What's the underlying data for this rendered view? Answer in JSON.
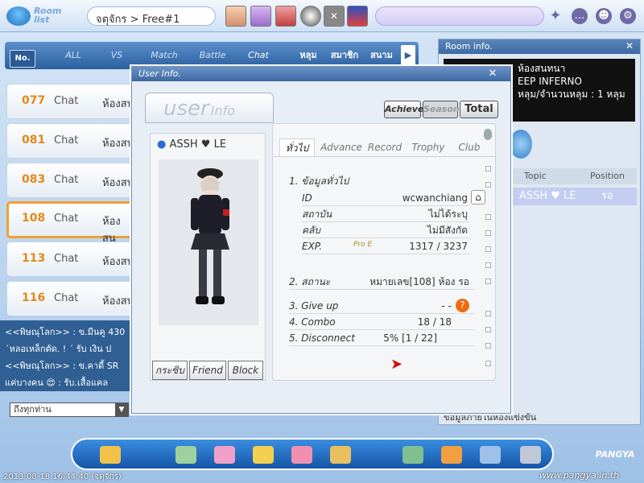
{
  "topbar": {
    "roomlist_label_1": "Room",
    "roomlist_label_2": "list",
    "breadcrumb": "จตุจักร > Free#1"
  },
  "tabs": {
    "no": "No.",
    "all": "ALL",
    "vs": "VS",
    "match": "Match",
    "battle": "Battle",
    "chat": "Chat",
    "hole": "หลุม",
    "member": "สมาชิก",
    "field": "สนาม"
  },
  "rooms": [
    {
      "num": "077",
      "type": "Chat",
      "name": "ห้องสน"
    },
    {
      "num": "081",
      "type": "Chat",
      "name": "ห้องสน"
    },
    {
      "num": "083",
      "type": "Chat",
      "name": "ห้องสน"
    },
    {
      "num": "108",
      "type": "Chat",
      "name": "ห้องสน"
    },
    {
      "num": "113",
      "type": "Chat",
      "name": "ห้องสน"
    },
    {
      "num": "116",
      "type": "Chat",
      "name": "ห้องสน"
    }
  ],
  "chatlog": [
    "<<พิษณุโลก>> : ข.มีนคู 430",
    "´หลอเหล็กตัด. ! ´ รับ เงิน ป",
    "<<พิษณุโลก>> : ข.คาดี้ SR",
    "แค่บางคน 😍 : รับ.เสื้อแคล"
  ],
  "chat_select": "ถึงทุกท่าน",
  "roominfo": {
    "title": "Room info.",
    "line1": "ห้องสนทนา",
    "line2": "EEP INFERNO",
    "line3": "หลุม/จำนวนหลุม : 1 หลุม",
    "col_topic": "Topic",
    "col_position": "Position",
    "player_name": "ASSH ♥ LE",
    "player_pos": "รอ",
    "footer": "ข้อมูลภายในห้องแข่งขัน"
  },
  "modal": {
    "title": "User Info.",
    "user_word": "user",
    "info_word": "Info",
    "achieve": "Achieve.",
    "season": "Season",
    "total": "Total",
    "player_name": "ASSH ♥ LE",
    "btn_whisper": "กระซิบ",
    "btn_friend": "Friend",
    "btn_block": "Block",
    "tabs": [
      "ทั่วไป",
      "Advance",
      "Record",
      "Trophy",
      "Club"
    ],
    "sec1": "1. ข้อมูลทั่วไป",
    "id_k": "ID",
    "id_v": "wcwanchiang",
    "inst_k": "สถาบัน",
    "inst_v": "ไม่ได้ระบุ",
    "club_k": "คลับ",
    "club_v": "ไม่มีสังกัด",
    "exp_k": "EXP.",
    "exp_rank": "Pro E",
    "exp_v": "1317 / 3237",
    "status_k": "2. สถานะ",
    "status_v": "หมายเลข[108] ห้อง รอ",
    "giveup_k": "3. Give up",
    "giveup_v": "- -",
    "combo_k": "4. Combo",
    "combo_v": "18 / 18",
    "disc_k": "5. Disconnect",
    "disc_v": "5% [1 / 22]"
  },
  "footer": {
    "timestamp": "2013-08-18 16:44:40 (จตุจักร)",
    "url": "www.pangya.in.th",
    "logo": "PANGYA"
  },
  "colors": {
    "accent": "#3c6aa4",
    "room_num": "#e08a1a",
    "selected": "#f0a030"
  },
  "icons": [
    "room-list-icon",
    "search-icon",
    "sparkle-icon",
    "chat-bubble-icon",
    "ghost-icon",
    "settings-icon",
    "close-icon",
    "help-icon",
    "refresh-icon",
    "home-icon"
  ]
}
